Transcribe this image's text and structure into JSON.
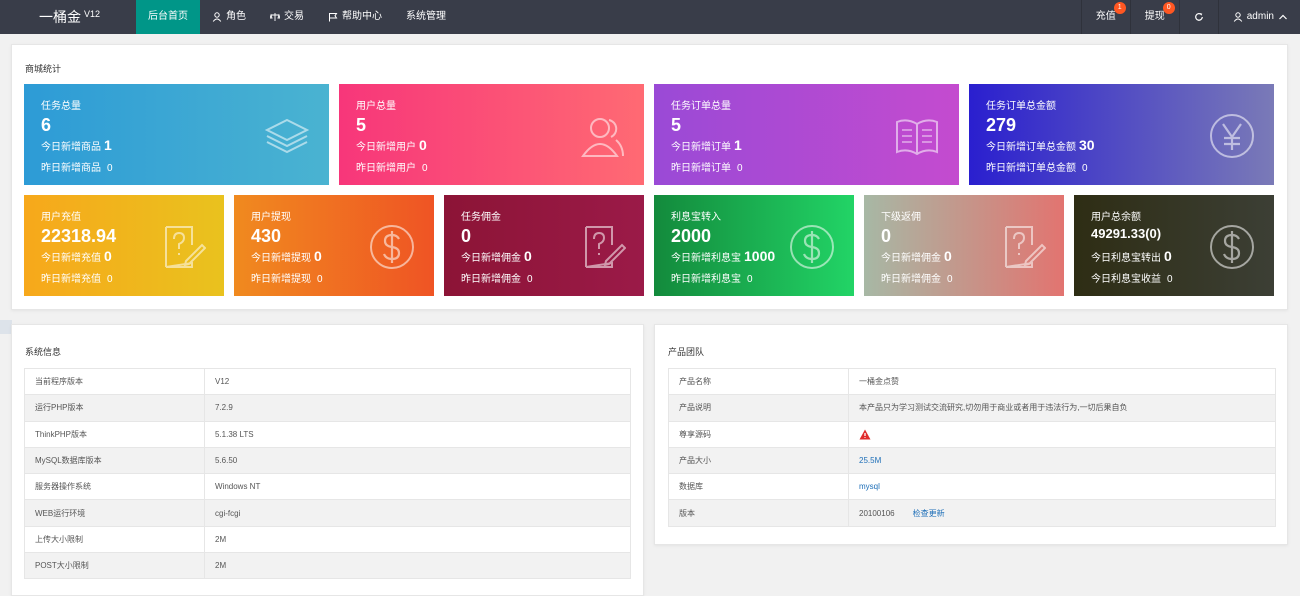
{
  "header": {
    "app_name": "一桶金",
    "version_sup": "V12",
    "nav": [
      {
        "label": "后台首页",
        "icon": "none"
      },
      {
        "label": "角色",
        "icon": "user-icon"
      },
      {
        "label": "交易",
        "icon": "scale-icon"
      },
      {
        "label": "帮助中心",
        "icon": "flag-icon"
      },
      {
        "label": "系统管理",
        "icon": "none"
      }
    ],
    "recharge_label": "充值",
    "recharge_badge": "1",
    "withdraw_label": "提现",
    "withdraw_badge": "0",
    "user_label": "admin"
  },
  "stats": {
    "title": "商城统计",
    "cards": [
      {
        "title": "任务总量",
        "value": "6",
        "today_label": "今日新增商品",
        "today": "1",
        "yest_label": "昨日新增商品",
        "yest": "0",
        "icon": "layers-icon",
        "from": "#2d9bd6",
        "to": "#4ab3d1"
      },
      {
        "title": "用户总量",
        "value": "5",
        "today_label": "今日新增用户",
        "today": "0",
        "yest_label": "昨日新增用户",
        "yest": "0",
        "icon": "users-icon",
        "from": "#f7367a",
        "to": "#ff6a73"
      },
      {
        "title": "任务订单总量",
        "value": "5",
        "today_label": "今日新增订单",
        "today": "1",
        "yest_label": "昨日新增订单",
        "yest": "0",
        "icon": "book-icon",
        "from": "#9a4ad6",
        "to": "#c44bcf"
      },
      {
        "title": "任务订单总金额",
        "value": "279",
        "today_label": "今日新增订单总金额",
        "today": "30",
        "yest_label": "昨日新增订单总金额",
        "yest": "0",
        "icon": "yen-icon",
        "from": "#2a1fcf",
        "to": "#7a7ab7"
      },
      {
        "title": "用户充值",
        "value": "22318.94",
        "today_label": "今日新增充值",
        "today": "0",
        "yest_label": "昨日新增充值",
        "yest": "0",
        "icon": "edit-question-icon",
        "from": "#f7a81b",
        "to": "#e9c21e"
      },
      {
        "title": "用户提现",
        "value": "430",
        "today_label": "今日新增提现",
        "today": "0",
        "yest_label": "昨日新增提现",
        "yest": "0",
        "icon": "dollar-icon",
        "from": "#f08a1f",
        "to": "#ef5424"
      },
      {
        "title": "任务佣金",
        "value": "0",
        "today_label": "今日新增佣金",
        "today": "0",
        "yest_label": "昨日新增佣金",
        "yest": "0",
        "icon": "edit-question-icon",
        "from": "#8c1436",
        "to": "#9b1a48"
      },
      {
        "title": "利息宝转入",
        "value": "2000",
        "today_label": "今日新增利息宝",
        "today": "1000",
        "yest_label": "昨日新增利息宝",
        "yest": "0",
        "icon": "dollar-icon",
        "from": "#138a3c",
        "to": "#22d466"
      },
      {
        "title": "下级返佣",
        "value": "0",
        "today_label": "今日新增佣金",
        "today": "0",
        "yest_label": "昨日新增佣金",
        "yest": "0",
        "icon": "edit-question-icon",
        "from": "#a7b8a5",
        "to": "#e27470"
      },
      {
        "title": "用户总余额",
        "value": "49291.33(0)",
        "today_label": "今日利息宝转出",
        "today": "0",
        "yest_label": "今日利息宝收益",
        "yest": "0",
        "icon": "dollar-icon",
        "from": "#2e2d14",
        "to": "#3c3f35"
      }
    ]
  },
  "system_info": {
    "title": "系统信息",
    "rows": [
      {
        "label": "当前程序版本",
        "value": "V12"
      },
      {
        "label": "运行PHP版本",
        "value": "7.2.9"
      },
      {
        "label": "ThinkPHP版本",
        "value": "5.1.38 LTS"
      },
      {
        "label": "MySQL数据库版本",
        "value": "5.6.50"
      },
      {
        "label": "服务器操作系统",
        "value": "Windows NT"
      },
      {
        "label": "WEB运行环境",
        "value": "cgi-fcgi"
      },
      {
        "label": "上传大小限制",
        "value": "2M"
      },
      {
        "label": "POST大小限制",
        "value": "2M"
      }
    ]
  },
  "product_team": {
    "title": "产品团队",
    "rows": [
      {
        "label": "产品名称",
        "value": "一桶金点赞"
      },
      {
        "label": "产品说明",
        "value": "本产品只为学习测试交流研究,切勿用于商业或者用于违法行为,一切后果自负"
      },
      {
        "label": "尊享源码",
        "value": ""
      },
      {
        "label": "产品大小",
        "value": "25.5M"
      },
      {
        "label": "数据库",
        "value": "mysql"
      },
      {
        "label": "版本",
        "value": "20100106"
      }
    ],
    "check_update": "检查更新"
  }
}
